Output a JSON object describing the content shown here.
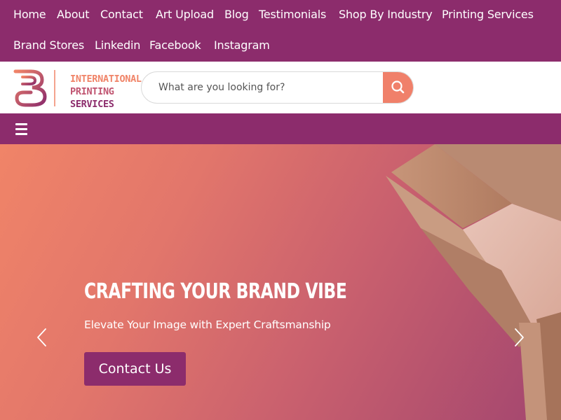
{
  "top_links": [
    "Home",
    "About",
    "Contact",
    "Art Upload",
    "Blog",
    "Testimonials",
    "Shop By Industry",
    "Printing Services",
    "Brand Stores",
    "Linkedin",
    "Facebook",
    "Instagram"
  ],
  "logo": {
    "line1": "INTERNATIONAL",
    "line2": "PRINTING",
    "line3": "SERVICES"
  },
  "search": {
    "placeholder": "What are you looking for?",
    "icon": "search-icon"
  },
  "nav": {
    "icon": "hamburger-menu-icon"
  },
  "hero": {
    "title": "CRAFTING YOUR BRAND VIBE",
    "subtitle": "Elevate Your Image with Expert Craftsmanship",
    "button_label": "Contact Us",
    "prev_icon": "chevron-left-icon",
    "next_icon": "chevron-right-icon"
  },
  "colors": {
    "brand_purple": "#8c2c6c",
    "accent_coral": "#f0806a",
    "text_white": "#ffffff"
  }
}
